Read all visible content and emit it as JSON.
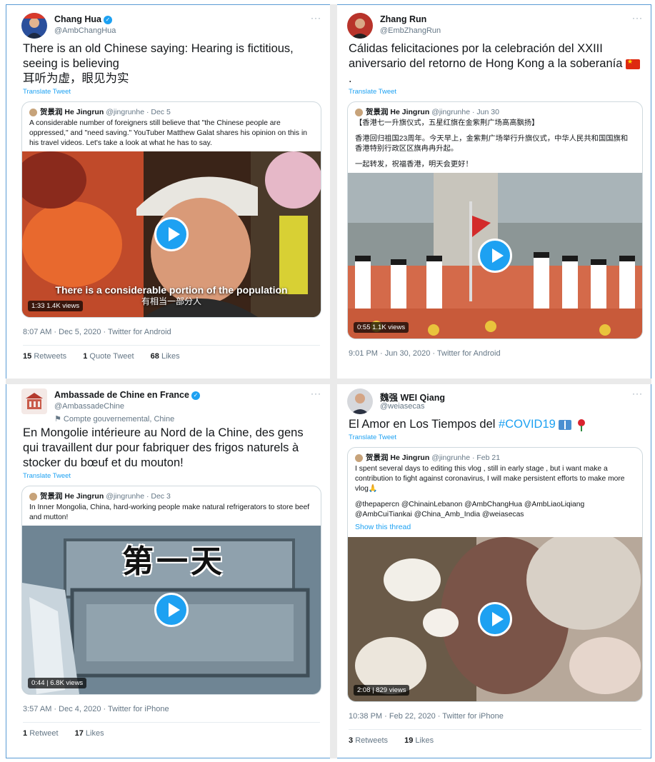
{
  "tweets": [
    {
      "name": "Chang Hua",
      "handle": "@AmbChangHua",
      "verified": true,
      "more": "···",
      "text_line1": "There is an old Chinese saying: Hearing is fictitious, seeing is believing",
      "text_line2": "耳听为虚，眼见为实",
      "translate": "Translate Tweet",
      "quote": {
        "name": "贺景润 He Jingrun",
        "handle_date": "@jingrunhe · Dec 5",
        "text": "A considerable number of foreigners still believe that \"the Chinese people are oppressed,\" and \"need saving.\" YouTuber Matthew Galat shares his opinion on this in his travel videos. Let's take a look at what he has to say.",
        "video_badge": "1:33  1.4K views",
        "subtitle_en": "There is a considerable portion of the population",
        "subtitle_cn": "有相当一部分人"
      },
      "meta": "8:07 AM · Dec 5, 2020 · Twitter for Android",
      "stats": [
        {
          "num": "15",
          "label": "Retweets"
        },
        {
          "num": "1",
          "label": "Quote Tweet"
        },
        {
          "num": "68",
          "label": "Likes"
        }
      ]
    },
    {
      "name": "Zhang Run",
      "handle": "@EmbZhangRun",
      "more": "···",
      "text": "Cálidas felicitaciones por la celebración del XXIII aniversario del retorno de Hong Kong a la soberanía",
      "flag": "china-flag",
      "quote": {
        "name": "贺景润 He Jingrun",
        "handle_date": "@jingrunhe · Jun 30",
        "text_p1": "【香港七一升旗仪式，五星红旗在金紫荆广场高高飘扬】",
        "text_p2": "香港回归祖国23周年。今天早上，金紫荆广场举行升旗仪式，中华人民共和国国旗和香港特别行政区区旗冉冉升起。",
        "text_p3": "一起转发，祝福香港，明天会更好！",
        "video_badge": "0:55  1.1K views"
      },
      "meta": "9:01 PM · Jun 30, 2020 · Twitter for Android"
    },
    {
      "name": "Ambassade de Chine en France",
      "handle": "@AmbassadeChine",
      "gov_label": "⚑ Compte gouvernemental, Chine",
      "verified": true,
      "more": "···",
      "text": "En Mongolie intérieure au Nord de la Chine, des gens qui travaillent dur pour fabriquer des frigos naturels à stocker du bœuf et du mouton!",
      "translate": "Translate Tweet",
      "quote": {
        "name": "贺景润 He Jingrun",
        "handle_date": "@jingrunhe · Dec 3",
        "text": "In Inner Mongolia, China, hard-working people make natural refrigerators to store beef and mutton!",
        "overlay": "第一天",
        "video_badge": "0:44 | 6.8K views"
      },
      "meta": "3:57 AM · Dec 4, 2020 · Twitter for iPhone",
      "stats": [
        {
          "num": "1",
          "label": "Retweet"
        },
        {
          "num": "17",
          "label": "Likes"
        }
      ]
    },
    {
      "name": "魏强 WEI Qiang",
      "handle": "@weiasecas",
      "more": "···",
      "text_plain": "El Amor en Los Tiempos del ",
      "hashtag": "#COVID19",
      "icons": [
        "book-icon",
        "rose-icon"
      ],
      "translate": "Translate Tweet",
      "quote": {
        "name": "贺景润 He Jingrun",
        "handle_date": "@jingrunhe · Feb 21",
        "text_p1": "I spent several days to editing this vlog , still in early  stage , but i want make a contribution to fight against coronavirus, I will make persistent efforts to make more vlog🙏",
        "text_p2": "@thepapercn @ChinainLebanon @AmbChangHua @AmbLiaoLiqiang @AmbCuiTiankai @China_Amb_India @weiasecas",
        "show_thread": "Show this thread",
        "video_badge": "2:08 | 829 views"
      },
      "meta": "10:38 PM · Feb 22, 2020 · Twitter for iPhone",
      "stats": [
        {
          "num": "3",
          "label": "Retweets"
        },
        {
          "num": "19",
          "label": "Likes"
        }
      ]
    }
  ],
  "colors": {
    "accent": "#1da1f2",
    "text": "#14171a",
    "muted": "#657786",
    "border": "#cfd9de"
  }
}
